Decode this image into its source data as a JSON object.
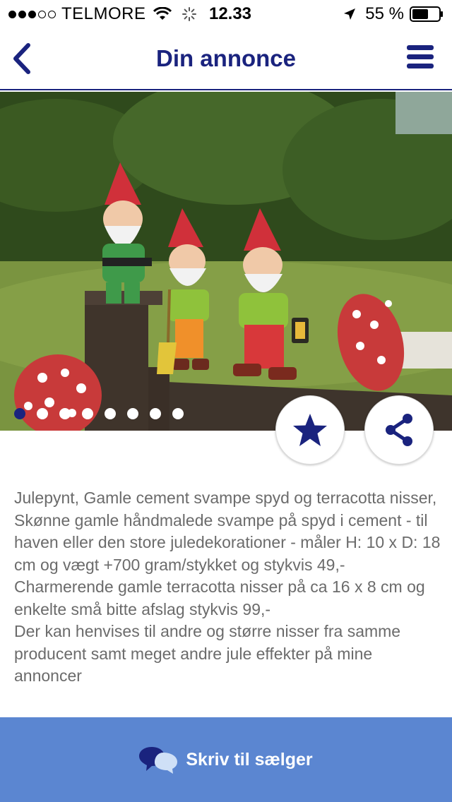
{
  "status_bar": {
    "carrier": "TELMORE",
    "time": "12.33",
    "battery": "55 %"
  },
  "nav": {
    "title": "Din annonce"
  },
  "image": {
    "page_count": 8,
    "active_page": 1
  },
  "description": [
    "Julepynt, Gamle cement svampe spyd og terracotta nisser, Skønne gamle håndmalede svampe på spyd i cement - til haven eller den store juledekorationer - måler H: 10 x D: 18 cm og vægt +700 gram/stykket og stykvis 49,-",
    "Charmerende gamle terracotta nisser på ca 16 x 8 cm og enkelte små bitte afslag stykvis 99,-",
    "Der kan henvises til andre og større nisser fra samme producent samt meget andre jule effekter på mine annoncer"
  ],
  "contact": {
    "label": "Skriv til sælger"
  },
  "colors": {
    "brand_navy": "#1a237e",
    "contact_bar": "#5b86d1",
    "description_text": "#6b6b6b"
  },
  "icons": [
    "back-chevron-icon",
    "hamburger-menu-icon",
    "star-icon",
    "share-icon",
    "chat-bubbles-icon"
  ]
}
